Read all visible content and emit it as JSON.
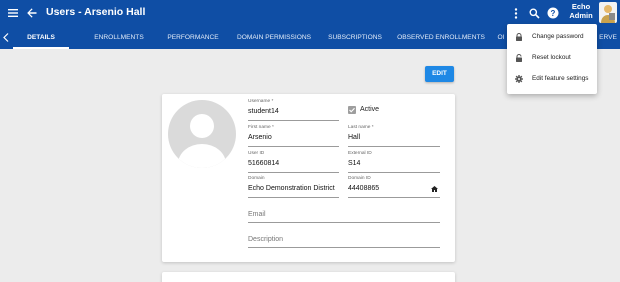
{
  "header": {
    "title": "Users - Arsenio Hall",
    "user_first": "Echo",
    "user_last": "Admin",
    "icons": [
      "menu-icon",
      "back-arrow-icon",
      "more-vert-icon",
      "search-icon",
      "help-icon"
    ]
  },
  "tabs": [
    {
      "label": "DETAILS",
      "active": true
    },
    {
      "label": "ENROLLMENTS"
    },
    {
      "label": "PERFORMANCE"
    },
    {
      "label": "DOMAIN PERMISSIONS"
    },
    {
      "label": "SUBSCRIPTIONS"
    },
    {
      "label": "OBSERVED ENROLLMENTS"
    },
    {
      "label": "OI"
    },
    {
      "label": "ERVE"
    }
  ],
  "actions": {
    "edit_label": "EDIT"
  },
  "profile": {
    "username": {
      "label": "Username *",
      "value": "student14"
    },
    "active": {
      "label": "Active",
      "checked": true
    },
    "first_name": {
      "label": "First name *",
      "value": "Arsenio"
    },
    "last_name": {
      "label": "Last name *",
      "value": "Hall"
    },
    "user_id": {
      "label": "User ID",
      "value": "51660814"
    },
    "external_id": {
      "label": "External ID",
      "value": "S14"
    },
    "domain": {
      "label": "Domain",
      "value": "Echo Demonstration District"
    },
    "domain_id": {
      "label": "Domain ID",
      "value": "44408865"
    },
    "email": {
      "placeholder": "Email"
    },
    "description": {
      "placeholder": "Description"
    }
  },
  "menu": {
    "items": [
      {
        "label": "Change password",
        "icon": "lock-icon"
      },
      {
        "label": "Reset lockout",
        "icon": "unlock-icon"
      },
      {
        "label": "Edit feature settings",
        "icon": "gear-icon"
      }
    ]
  },
  "colors": {
    "primary": "#0f4ea5",
    "accent": "#1e88e5",
    "background": "#ececec"
  }
}
